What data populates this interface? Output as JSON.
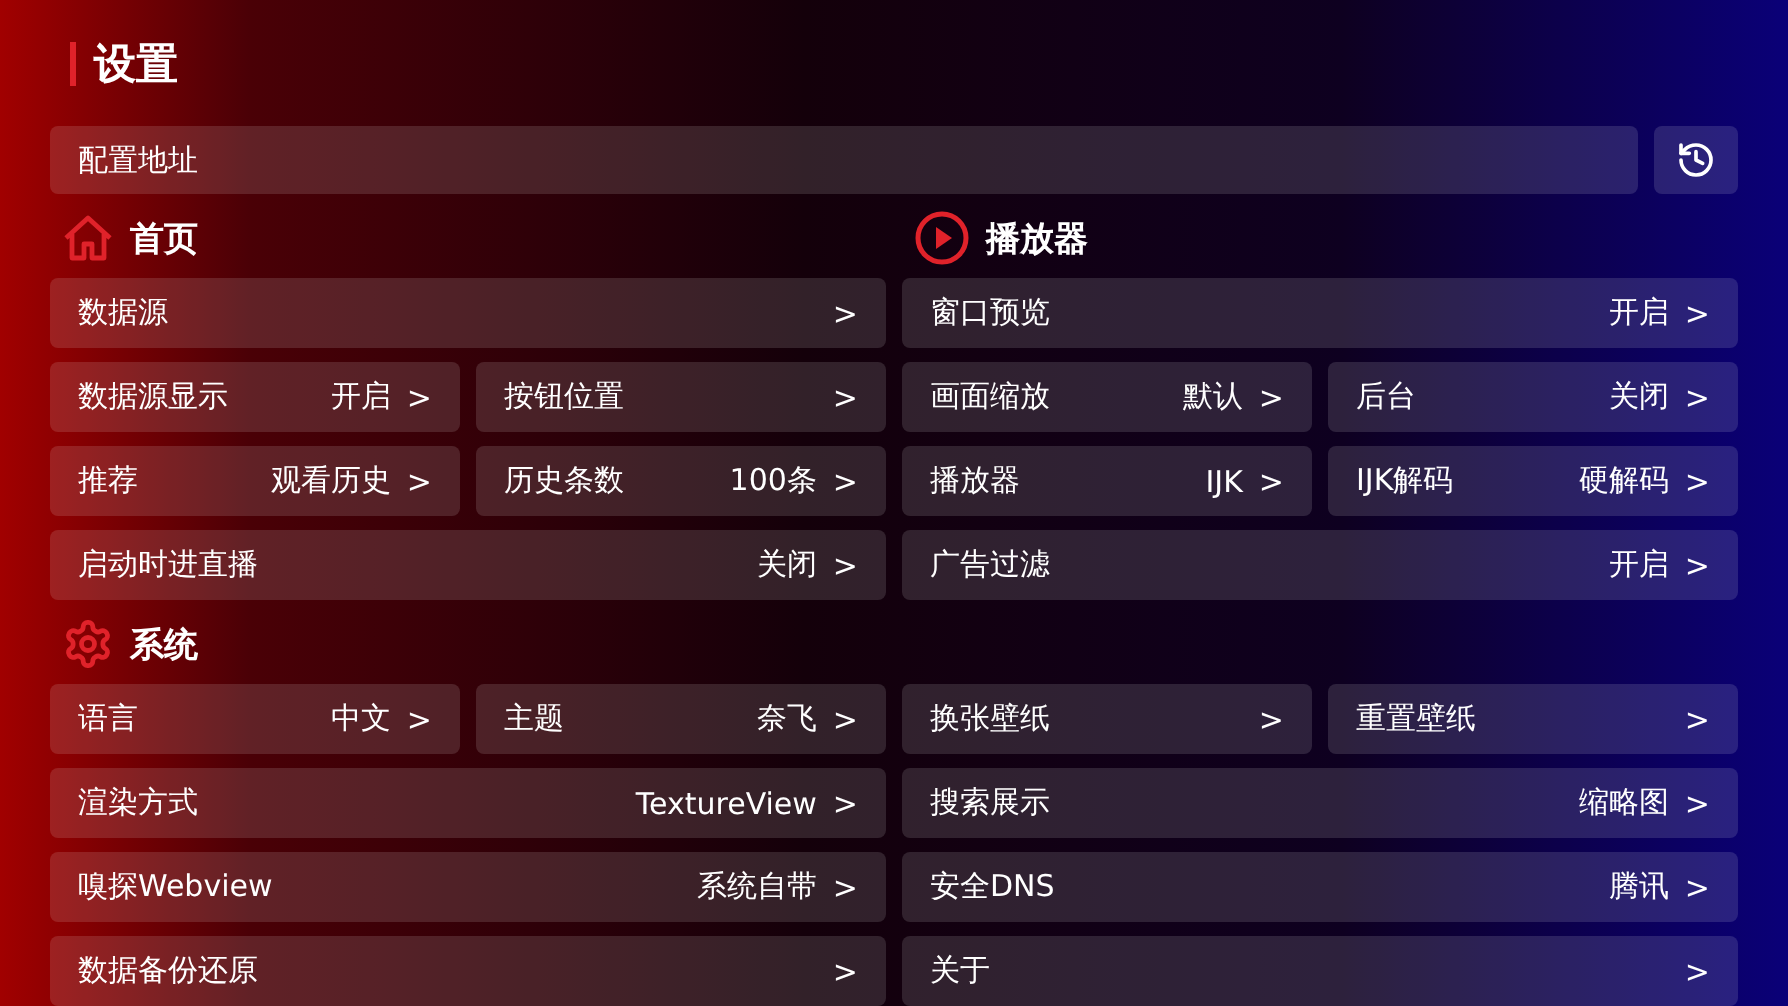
{
  "title": "设置",
  "address_field": {
    "value": "配置地址"
  },
  "groups": [
    {
      "headings": [
        {
          "title": "首页"
        },
        {
          "title": "播放器"
        }
      ],
      "rows": [
        {
          "left": [
            {
              "label": "数据源",
              "arrow": ">"
            }
          ],
          "right": [
            {
              "label": "窗口预览",
              "value": "开启",
              "arrow": ">"
            }
          ]
        },
        {
          "left": [
            {
              "label": "数据源显示",
              "value": "开启",
              "arrow": ">"
            },
            {
              "label": "按钮位置",
              "arrow": ">"
            }
          ],
          "right": [
            {
              "label": "画面缩放",
              "value": "默认",
              "arrow": ">"
            },
            {
              "label": "后台",
              "value": "关闭",
              "arrow": ">"
            }
          ]
        },
        {
          "left": [
            {
              "label": "推荐",
              "value": "观看历史",
              "arrow": ">"
            },
            {
              "label": "历史条数",
              "value": "100条",
              "arrow": ">"
            }
          ],
          "right": [
            {
              "label": "播放器",
              "value": "IJK",
              "arrow": ">"
            },
            {
              "label": "IJK解码",
              "value": "硬解码",
              "arrow": ">"
            }
          ]
        },
        {
          "left": [
            {
              "label": "启动时进直播",
              "value": "关闭",
              "arrow": ">"
            }
          ],
          "right": [
            {
              "label": "广告过滤",
              "value": "开启",
              "arrow": ">"
            }
          ]
        }
      ]
    },
    {
      "headings": [
        {
          "title": "系统"
        }
      ],
      "rows": [
        {
          "left": [
            {
              "label": "语言",
              "value": "中文",
              "arrow": ">"
            },
            {
              "label": "主题",
              "value": "奈飞",
              "arrow": ">"
            }
          ],
          "right": [
            {
              "label": "换张壁纸",
              "arrow": ">"
            },
            {
              "label": "重置壁纸",
              "arrow": ">"
            }
          ]
        },
        {
          "left": [
            {
              "label": "渲染方式",
              "value": "TextureView",
              "arrow": ">"
            }
          ],
          "right": [
            {
              "label": "搜索展示",
              "value": "缩略图",
              "arrow": ">"
            }
          ]
        },
        {
          "left": [
            {
              "label": "嗅探Webview",
              "value": "系统自带",
              "arrow": ">"
            }
          ],
          "right": [
            {
              "label": "安全DNS",
              "value": "腾讯",
              "arrow": ">"
            }
          ]
        },
        {
          "left": [
            {
              "label": "数据备份还原",
              "arrow": ">"
            }
          ],
          "right": [
            {
              "label": "关于",
              "arrow": ">"
            }
          ]
        }
      ]
    }
  ]
}
